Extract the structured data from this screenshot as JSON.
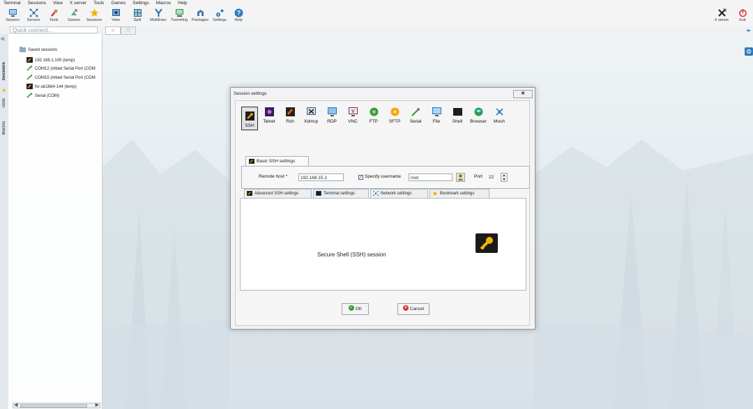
{
  "menu": [
    "Terminal",
    "Sessions",
    "View",
    "X server",
    "Tools",
    "Games",
    "Settings",
    "Macros",
    "Help"
  ],
  "toolbar": {
    "items": [
      {
        "label": "Session",
        "icon": "session-icon"
      },
      {
        "label": "Servers",
        "icon": "servers-icon"
      },
      {
        "label": "Tools",
        "icon": "tools-icon"
      },
      {
        "label": "Games",
        "icon": "games-icon"
      },
      {
        "label": "Sessions",
        "icon": "star-icon"
      },
      {
        "label": "View",
        "icon": "view-icon"
      },
      {
        "label": "Split",
        "icon": "split-icon"
      },
      {
        "label": "MultiExec",
        "icon": "multiexec-icon"
      },
      {
        "label": "Tunneling",
        "icon": "tunneling-icon"
      },
      {
        "label": "Packages",
        "icon": "packages-icon"
      },
      {
        "label": "Settings",
        "icon": "settings-icon"
      },
      {
        "label": "Help",
        "icon": "help-icon"
      }
    ],
    "xserver_label": "X server",
    "exit_label": "Exit"
  },
  "quick_connect": {
    "placeholder": "Quick connect..."
  },
  "side_tabs": {
    "sessions": "Sessions",
    "tools": "Tools",
    "macros": "Macros"
  },
  "sessions_tree": {
    "root": "Saved sessions",
    "items": [
      {
        "label": "192.168.1.100 (temp)",
        "icon": "ssh-icon"
      },
      {
        "label": "COM12  (mbed Serial Port (COM",
        "icon": "serial-icon"
      },
      {
        "label": "COM15  (mbed Serial Port (COM",
        "icon": "serial-icon"
      },
      {
        "label": "fsr-ub1664-144 (temp)",
        "icon": "ssh-icon"
      },
      {
        "label": "Serial (COM)",
        "icon": "serial-icon"
      }
    ]
  },
  "dialog": {
    "title": "Session settings",
    "session_types": [
      "SSH",
      "Telnet",
      "Rsh",
      "Xdmcp",
      "RDP",
      "VNC",
      "FTP",
      "SFTP",
      "Serial",
      "File",
      "Shell",
      "Browser",
      "Mosh"
    ],
    "selected_type": "SSH",
    "basic_tab": "Basic SSH settings",
    "remote_host_label": "Remote host *",
    "remote_host_value": "192.168.15.1",
    "specify_username_label": "Specify username",
    "username_value": "root",
    "port_label": "Port",
    "port_value": "22",
    "subtabs": [
      "Advanced SSH settings",
      "Terminal settings",
      "Network settings",
      "Bookmark settings"
    ],
    "description": "Secure Shell (SSH) session",
    "ok_label": "OK",
    "cancel_label": "Cancel"
  },
  "colors": {
    "accent": "#2f7bbd",
    "exit": "#e0302b",
    "ok": "#3a9b3a",
    "cancel": "#d9352d"
  }
}
